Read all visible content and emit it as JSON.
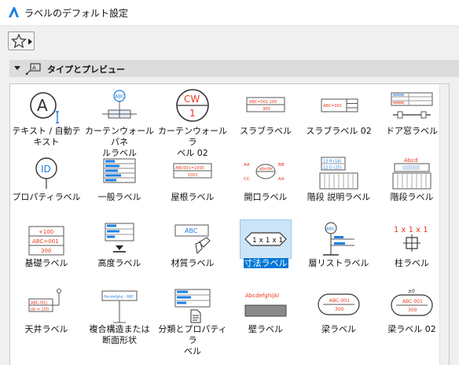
{
  "window": {
    "title": "ラベルのデフォルト設定"
  },
  "toolbar": {
    "favorites_icon": "star-icon"
  },
  "section": {
    "title": "タイプとプレビュー",
    "icon": "label-preview-icon"
  },
  "accent_color": "#e8391d",
  "selection_color": "#0078d7",
  "tiles": [
    {
      "label": "テキスト / 自動テ\nキスト",
      "preview": {
        "text": "A"
      }
    },
    {
      "label": "カーテンウォールパネ\nルラベル",
      "preview": {
        "text": "ABC"
      }
    },
    {
      "label": "カーテンウォールラ\nベル 02",
      "preview": {
        "top": "CW",
        "bottom": "1"
      }
    },
    {
      "label": "スラブラベル",
      "preview": {
        "line1": "ABC=001 100",
        "line2": "300"
      }
    },
    {
      "label": "スラブラベル 02",
      "preview": {
        "line1": "ABC=001"
      }
    },
    {
      "label": "ドア窓ラベル",
      "preview": {}
    },
    {
      "label": "プロパティラベル",
      "preview": {
        "text": "ID"
      }
    },
    {
      "label": "一般ラベル",
      "preview": {}
    },
    {
      "label": "屋根ラベル",
      "preview": {
        "line1": "ABC001=1000",
        "line2": "1001"
      }
    },
    {
      "label": "開口ラベル",
      "preview": {
        "tl": "AA",
        "tr": "BB",
        "center": "abcde",
        "bl": "CC",
        "br": "AA"
      }
    },
    {
      "label": "階段 説明ラベル",
      "preview": {
        "line1": "13 R (18)",
        "line2": "12 G (25)"
      }
    },
    {
      "label": "階段ラベル",
      "preview": {
        "text": "Abcd"
      }
    },
    {
      "label": "基礎ラベル",
      "preview": {
        "line1": "+100",
        "line2": "ABC=001",
        "line3": "300"
      }
    },
    {
      "label": "高度ラベル",
      "preview": {}
    },
    {
      "label": "材質ラベル",
      "preview": {
        "text": "ABC"
      }
    },
    {
      "label": "寸法ラベル",
      "preview": {
        "text": "1 x 1 x 1"
      }
    },
    {
      "label": "層リストラベル",
      "preview": {
        "text": "ABC"
      }
    },
    {
      "label": "柱ラベル",
      "preview": {
        "text": "1 x 1 x 1"
      }
    },
    {
      "label": "天井ラベル",
      "preview": {
        "line1": "ABC-001",
        "line2": "ab = 100"
      }
    },
    {
      "label": "複合構造または\n断面形状",
      "preview": {
        "text": "Abcdefghij - ABC"
      }
    },
    {
      "label": "分類とプロパティラ\nベル",
      "preview": {}
    },
    {
      "label": "壁ラベル",
      "preview": {
        "text": "Abcdefghijkl"
      }
    },
    {
      "label": "梁ラベル",
      "preview": {
        "line1": "ABC-001",
        "line2": "300"
      }
    },
    {
      "label": "梁ラベル 02",
      "preview": {
        "top": "±0",
        "line1": "ABC-001",
        "line2": "300"
      }
    }
  ],
  "selected_index": 15
}
